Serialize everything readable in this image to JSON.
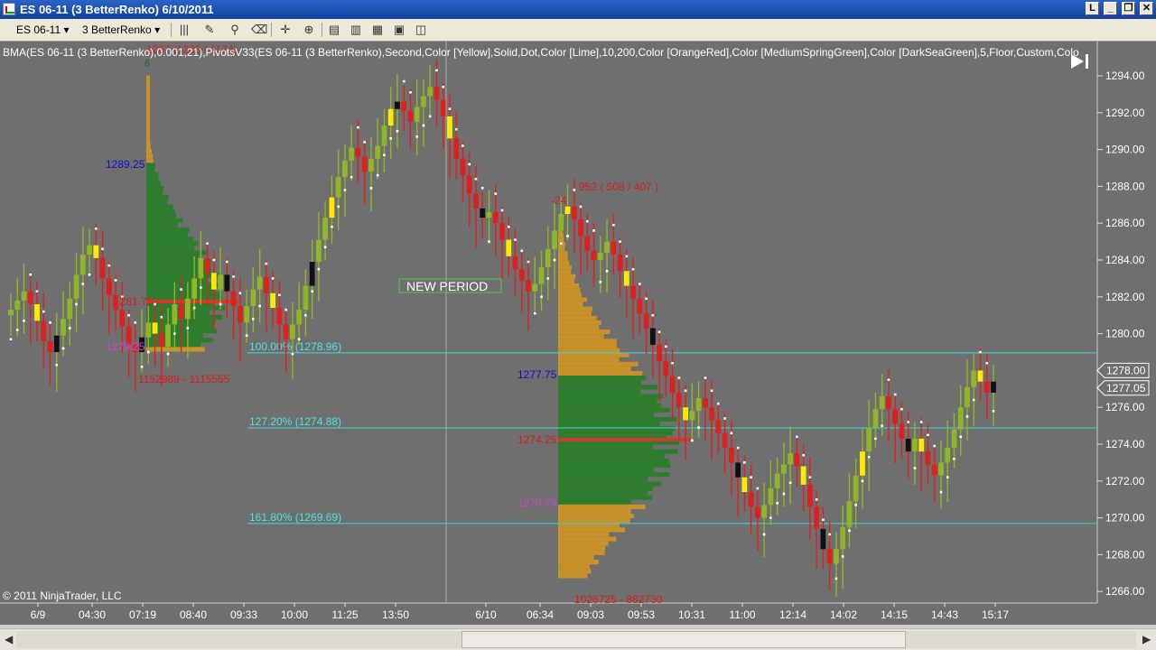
{
  "window": {
    "title": "ES 06-11 (3 BetterRenko)  6/10/2011"
  },
  "window_buttons": [
    "L",
    "_",
    "❐",
    "✕"
  ],
  "toolbar": {
    "instrument": "ES 06-11",
    "period": "3 BetterRenko"
  },
  "indicator_label": "BMA(ES 06-11 (3 BetterRenko),0.001,21),PivotsV33(ES 06-11 (3 BetterRenko),Second,Color [Yellow],Solid,Dot,Color [Lime],10,200,Color [OrangeRed],Color [MediumSpringGreen],Color [DarkSeaGreen],5,Floor,Custom,Colo",
  "copyright": "© 2011 NinjaTrader, LLC",
  "chart_data": {
    "type": "candlestick-renko",
    "y_axis": {
      "ticks": [
        "1294.00",
        "1292.00",
        "1290.00",
        "1288.00",
        "1286.00",
        "1284.00",
        "1282.00",
        "1280.00",
        "1278.00",
        "1276.00",
        "1274.00",
        "1272.00",
        "1270.00",
        "1268.00",
        "1266.00"
      ],
      "ylim": [
        1265.3,
        1294.9
      ]
    },
    "x_axis": {
      "ticks": [
        "6/9",
        "04:30",
        "07:19",
        "08:40",
        "09:33",
        "10:00",
        "11:25",
        "13:50",
        "6/10",
        "06:34",
        "09:03",
        "09:53",
        "10:31",
        "11:00",
        "12:14",
        "14:02",
        "14:15",
        "14:43",
        "15:17"
      ]
    },
    "price_markers": [
      {
        "value": 1278.0,
        "label": "1278.00"
      },
      {
        "value": 1277.05,
        "label": "1277.05"
      }
    ],
    "fib_levels": [
      {
        "price": 1278.96,
        "label": "100.00% (1278.96)"
      },
      {
        "price": 1274.88,
        "label": "127.20% (1274.88)"
      },
      {
        "price": 1269.69,
        "label": "161.80% (1269.69)"
      }
    ],
    "annotations": {
      "new_period": "NEW PERIOD",
      "vp1_high": "1289.25",
      "vp1_poc": "1281.75",
      "vp1_low": "1279.25",
      "vp1_volume": "1152989 - 1115555",
      "vp1_top_label": "1267 (1205 / 1174)",
      "vp1_marker": "6",
      "vp2_high": "1277.75",
      "vp2_poc": "1274.25",
      "vp2_low": "1270.75",
      "vp2_volume": "1028725 - 882730",
      "vp2_top_delta": "-24",
      "vp2_top_volume": "952 ( 508 / 407 )"
    },
    "closes": [
      1281.3,
      1281.8,
      1282.3,
      1281.6,
      1280.7,
      1279.6,
      1279.0,
      1279.9,
      1280.8,
      1281.9,
      1283.2,
      1284.3,
      1284.8,
      1284.1,
      1283.0,
      1282.1,
      1281.3,
      1280.4,
      1279.4,
      1279.0,
      1279.8,
      1280.6,
      1280.0,
      1279.3,
      1280.5,
      1281.6,
      1280.8,
      1281.9,
      1283.0,
      1284.1,
      1283.3,
      1282.4,
      1283.2,
      1282.3,
      1281.5,
      1280.6,
      1281.5,
      1282.4,
      1283.1,
      1282.2,
      1281.4,
      1280.5,
      1279.7,
      1280.5,
      1281.3,
      1282.6,
      1283.9,
      1285.1,
      1286.3,
      1287.4,
      1288.5,
      1289.4,
      1290.1,
      1289.6,
      1288.8,
      1289.5,
      1290.2,
      1291.3,
      1292.2,
      1292.6,
      1292.1,
      1291.5,
      1292.3,
      1292.9,
      1293.4,
      1292.7,
      1291.8,
      1290.6,
      1289.5,
      1288.6,
      1287.6,
      1286.8,
      1286.3,
      1286.6,
      1286.0,
      1285.1,
      1284.2,
      1283.5,
      1282.9,
      1282.3,
      1282.7,
      1283.6,
      1284.6,
      1285.6,
      1286.5,
      1286.9,
      1286.2,
      1285.3,
      1284.5,
      1284.0,
      1284.4,
      1285.0,
      1284.3,
      1283.4,
      1282.6,
      1281.9,
      1281.1,
      1280.3,
      1279.4,
      1278.5,
      1277.7,
      1276.8,
      1276.0,
      1275.3,
      1275.8,
      1276.5,
      1276.0,
      1275.3,
      1274.6,
      1273.8,
      1273.0,
      1272.2,
      1271.4,
      1270.6,
      1270.0,
      1270.7,
      1271.6,
      1272.4,
      1272.9,
      1273.5,
      1272.8,
      1271.8,
      1270.6,
      1269.4,
      1268.3,
      1267.5,
      1268.3,
      1269.5,
      1270.9,
      1272.3,
      1273.6,
      1274.9,
      1275.9,
      1276.6,
      1275.9,
      1275.1,
      1274.3,
      1273.6,
      1274.3,
      1273.6,
      1272.9,
      1272.3,
      1273.0,
      1273.8,
      1274.8,
      1276.0,
      1277.1,
      1278.0,
      1277.4,
      1276.8,
      1277.4
    ]
  }
}
